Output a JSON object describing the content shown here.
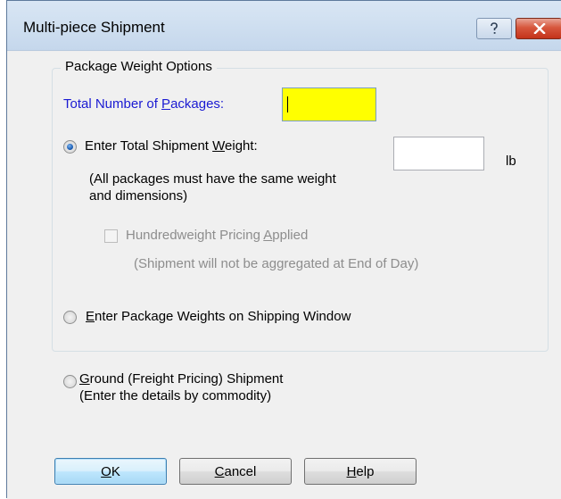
{
  "window": {
    "title": "Multi-piece Shipment",
    "help_glyph": "?",
    "close_glyph": "x"
  },
  "group": {
    "legend": "Package Weight Options",
    "total_packages": {
      "label_prefix": "Total Number of ",
      "label_accel": "P",
      "label_suffix": "ackages:",
      "value": "",
      "highlight_color": "#ffff00"
    },
    "total_weight_option": {
      "label_prefix": "Enter Total Shipment ",
      "label_accel": "W",
      "label_suffix": "eight:",
      "selected": true,
      "weight_value": "",
      "unit": "lb",
      "note_line1": "(All packages must have the same weight",
      "note_line2": "and dimensions)"
    },
    "hundredweight": {
      "label_prefix": "Hundredweight Pricing ",
      "label_accel": "A",
      "label_suffix": "pplied",
      "checked": false,
      "enabled": false,
      "note": "(Shipment will not be aggregated at End of Day)"
    },
    "package_weights_option": {
      "label_accel": "E",
      "label_suffix": "nter Package Weights on Shipping Window",
      "selected": false
    }
  },
  "ground_option": {
    "label_accel": "G",
    "label_suffix": "round (Freight Pricing) Shipment",
    "note": "(Enter the details by commodity)",
    "selected": false
  },
  "buttons": {
    "ok": {
      "accel": "O",
      "rest": "K"
    },
    "cancel": {
      "accel": "C",
      "rest": "ancel"
    },
    "help": {
      "accel": "H",
      "rest": "elp"
    }
  },
  "colors": {
    "link_blue": "#1a1ad2",
    "disabled_grey": "#8d8d8d",
    "close_red": "#c4321a"
  }
}
